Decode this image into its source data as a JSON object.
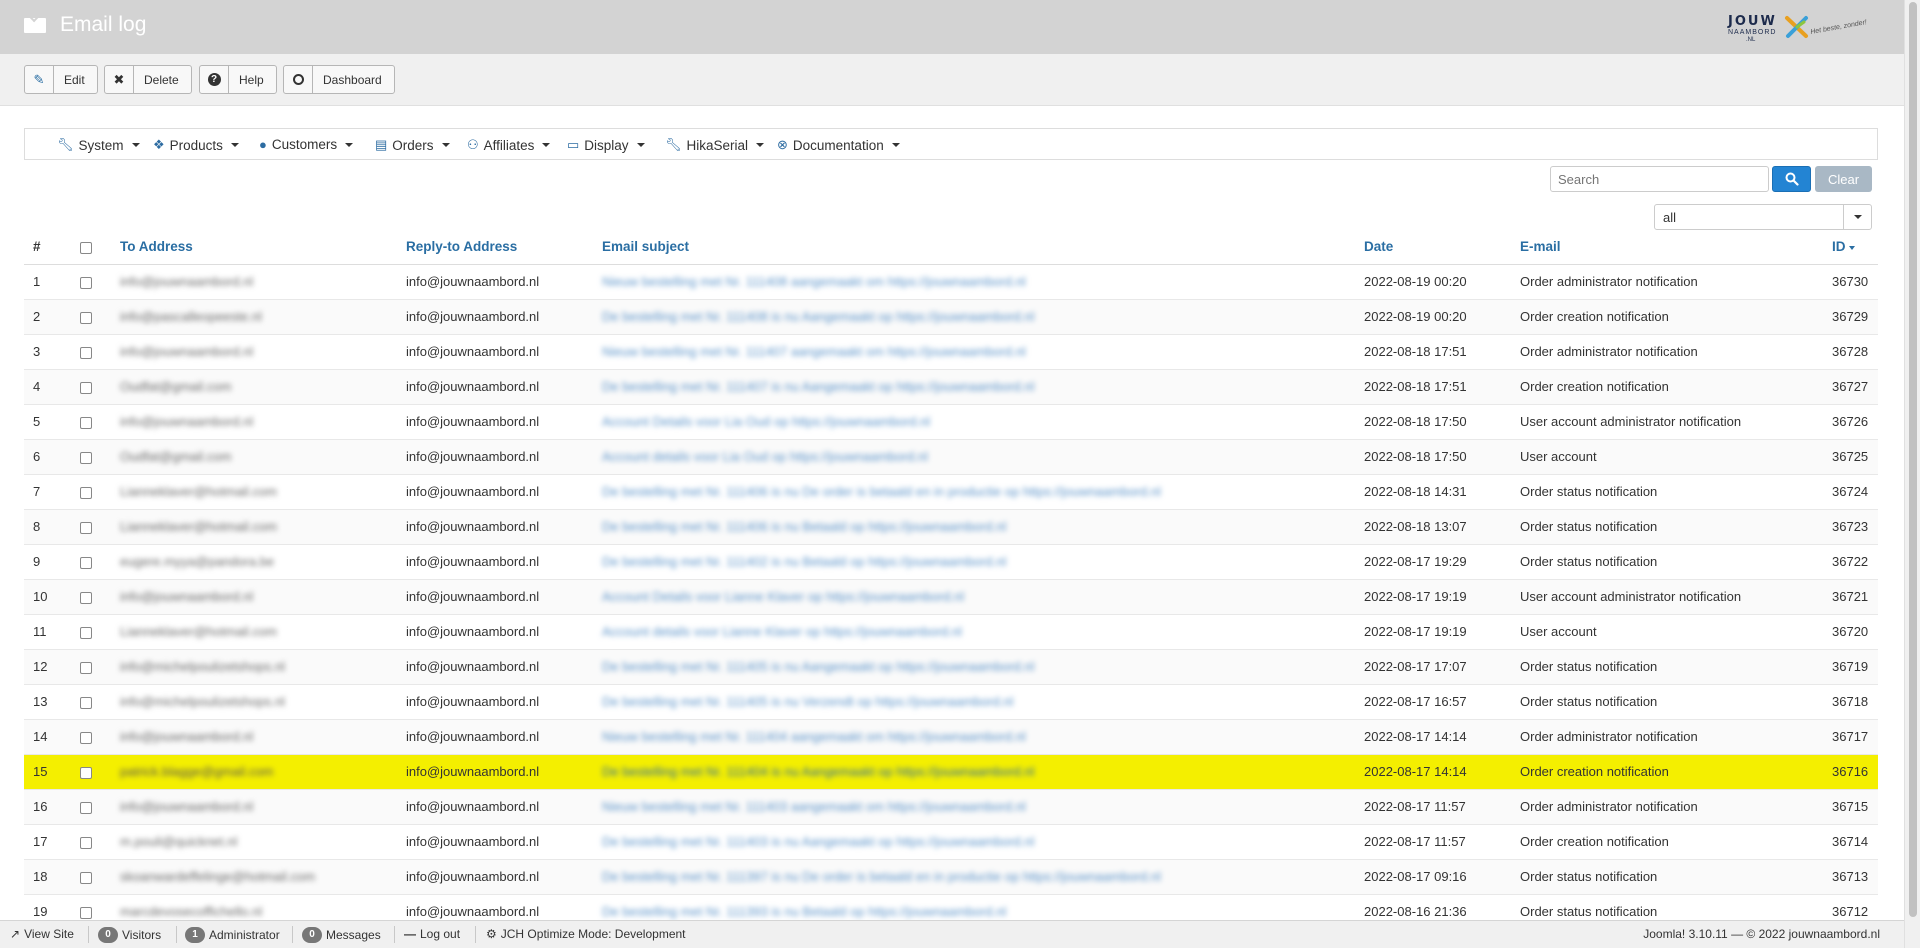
{
  "header": {
    "title": "Email log",
    "icon": "envelope-icon",
    "logo": {
      "line1": "JOUW",
      "line2": "NAAMBORD",
      "line3": ".NL",
      "tagline": "Het beste, zonder!"
    }
  },
  "toolbar": [
    {
      "label": "Edit",
      "icon": "edit-icon",
      "glyph": "✎"
    },
    {
      "label": "Delete",
      "icon": "close-icon",
      "glyph": "✖"
    },
    {
      "label": "Help",
      "icon": "help-icon",
      "glyph": "?"
    },
    {
      "label": "Dashboard",
      "icon": "dashboard-icon",
      "glyph": "◴"
    }
  ],
  "menu": [
    {
      "label": "System",
      "icon": "wrench-icon",
      "glyph": "🔧"
    },
    {
      "label": "Products",
      "icon": "cubes-icon",
      "glyph": "❖"
    },
    {
      "label": "Customers",
      "icon": "user-icon",
      "glyph": "👤"
    },
    {
      "label": "Orders",
      "icon": "credit-card-icon",
      "glyph": "▭"
    },
    {
      "label": "Affiliates",
      "icon": "users-icon",
      "glyph": "⚇"
    },
    {
      "label": "Display",
      "icon": "monitor-icon",
      "glyph": "▭"
    },
    {
      "label": "HikaSerial",
      "icon": "wrench-icon",
      "glyph": "🔧"
    },
    {
      "label": "Documentation",
      "icon": "lifebuoy-icon",
      "glyph": "⊗"
    }
  ],
  "search": {
    "placeholder": "Search",
    "clear_label": "Clear"
  },
  "filter": {
    "selected": "all"
  },
  "table": {
    "headers": {
      "num": "#",
      "to": "To Address",
      "reply": "Reply-to Address",
      "subject": "Email subject",
      "date": "Date",
      "email": "E-mail",
      "id": "ID"
    },
    "rows": [
      {
        "num": "1",
        "to": "info@jouwnaambord.nl",
        "reply": "info@jouwnaambord.nl",
        "subject": "Nieuw bestelling met Nr. 111408 aangemaakt om https://jouwnaambord.nl",
        "date": "2022-08-19 00:20",
        "type": "Order administrator notification",
        "id": "36730"
      },
      {
        "num": "2",
        "to": "info@pascalleopeeste.nl",
        "reply": "info@jouwnaambord.nl",
        "subject": "De bestelling met Nr. 111408 is nu Aangemaakt op https://jouwnaambord.nl",
        "date": "2022-08-19 00:20",
        "type": "Order creation notification",
        "id": "36729"
      },
      {
        "num": "3",
        "to": "info@jouwnaambord.nl",
        "reply": "info@jouwnaambord.nl",
        "subject": "Nieuw bestelling met Nr. 111407 aangemaakt om https://jouwnaambord.nl",
        "date": "2022-08-18 17:51",
        "type": "Order administrator notification",
        "id": "36728"
      },
      {
        "num": "4",
        "to": "Oudfat@gmail.com",
        "reply": "info@jouwnaambord.nl",
        "subject": "De bestelling met Nr. 111407 is nu Aangemaakt op https://jouwnaambord.nl",
        "date": "2022-08-18 17:51",
        "type": "Order creation notification",
        "id": "36727"
      },
      {
        "num": "5",
        "to": "info@jouwnaambord.nl",
        "reply": "info@jouwnaambord.nl",
        "subject": "Account Details voor Lia Oud op https://jouwnaambord.nl",
        "date": "2022-08-18 17:50",
        "type": "User account administrator notification",
        "id": "36726"
      },
      {
        "num": "6",
        "to": "Oudfat@gmail.com",
        "reply": "info@jouwnaambord.nl",
        "subject": "Account details voor Lia Oud op https://jouwnaambord.nl",
        "date": "2022-08-18 17:50",
        "type": "User account",
        "id": "36725"
      },
      {
        "num": "7",
        "to": "Lianneklaver@hotmail.com",
        "reply": "info@jouwnaambord.nl",
        "subject": "De bestelling met Nr. 111406 is nu De order is betaald en in productie op https://jouwnaambord.nl",
        "date": "2022-08-18 14:31",
        "type": "Order status notification",
        "id": "36724"
      },
      {
        "num": "8",
        "to": "Lianneklaver@hotmail.com",
        "reply": "info@jouwnaambord.nl",
        "subject": "De bestelling met Nr. 111406 is nu Betaald op https://jouwnaambord.nl",
        "date": "2022-08-18 13:07",
        "type": "Order status notification",
        "id": "36723"
      },
      {
        "num": "9",
        "to": "eugere.myya@pandora.be",
        "reply": "info@jouwnaambord.nl",
        "subject": "De bestelling met Nr. 111402 is nu Betaald op https://jouwnaambord.nl",
        "date": "2022-08-17 19:29",
        "type": "Order status notification",
        "id": "36722"
      },
      {
        "num": "10",
        "to": "info@jouwnaambord.nl",
        "reply": "info@jouwnaambord.nl",
        "subject": "Account Details voor Lianne Klaver op https://jouwnaambord.nl",
        "date": "2022-08-17 19:19",
        "type": "User account administrator notification",
        "id": "36721"
      },
      {
        "num": "11",
        "to": "Lianneklaver@hotmail.com",
        "reply": "info@jouwnaambord.nl",
        "subject": "Account details voor Lianne Klaver op https://jouwnaambord.nl",
        "date": "2022-08-17 19:19",
        "type": "User account",
        "id": "36720"
      },
      {
        "num": "12",
        "to": "info@michelpoulizetshops.nl",
        "reply": "info@jouwnaambord.nl",
        "subject": "De bestelling met Nr. 111405 is nu Aangemaakt op https://jouwnaambord.nl",
        "date": "2022-08-17 17:07",
        "type": "Order status notification",
        "id": "36719"
      },
      {
        "num": "13",
        "to": "info@michelpoulizetshops.nl",
        "reply": "info@jouwnaambord.nl",
        "subject": "De bestelling met Nr. 111405 is nu Verzendt op https://jouwnaambord.nl",
        "date": "2022-08-17 16:57",
        "type": "Order status notification",
        "id": "36718"
      },
      {
        "num": "14",
        "to": "info@jouwnaambord.nl",
        "reply": "info@jouwnaambord.nl",
        "subject": "Nieuw bestelling met Nr. 111404 aangemaakt om https://jouwnaambord.nl",
        "date": "2022-08-17 14:14",
        "type": "Order administrator notification",
        "id": "36717"
      },
      {
        "num": "15",
        "to": "patrick.blagge@gmail.com",
        "reply": "info@jouwnaambord.nl",
        "subject": "De bestelling met Nr. 111404 is nu Aangemaakt op https://jouwnaambord.nl",
        "date": "2022-08-17 14:14",
        "type": "Order creation notification",
        "id": "36716",
        "highlight": true
      },
      {
        "num": "16",
        "to": "info@jouwnaambord.nl",
        "reply": "info@jouwnaambord.nl",
        "subject": "Nieuw bestelling met Nr. 111403 aangemaakt om https://jouwnaambord.nl",
        "date": "2022-08-17 11:57",
        "type": "Order administrator notification",
        "id": "36715"
      },
      {
        "num": "17",
        "to": "m.pouli@quicknet.nl",
        "reply": "info@jouwnaambord.nl",
        "subject": "De bestelling met Nr. 111403 is nu Aangemaakt op https://jouwnaambord.nl",
        "date": "2022-08-17 11:57",
        "type": "Order creation notification",
        "id": "36714"
      },
      {
        "num": "18",
        "to": "skoanwardeffelinge@hotmail.com",
        "reply": "info@jouwnaambord.nl",
        "subject": "De bestelling met Nr. 111397 is nu De order is betaald en in productie op https://jouwnaambord.nl",
        "date": "2022-08-17 09:16",
        "type": "Order status notification",
        "id": "36713"
      },
      {
        "num": "19",
        "to": "marcdevosecoffichello.nl",
        "reply": "info@jouwnaambord.nl",
        "subject": "De bestelling met Nr. 111393 is nu Betaald op https://jouwnaambord.nl",
        "date": "2022-08-16 21:36",
        "type": "Order status notification",
        "id": "36712"
      }
    ]
  },
  "statusbar": {
    "view_site": "View Site",
    "visitors_count": "0",
    "visitors": "Visitors",
    "admin_count": "1",
    "admin": "Administrator",
    "messages_count": "0",
    "messages": "Messages",
    "logout": "Log out",
    "jch": "JCH Optimize Mode: Development",
    "right": "Joomla! 3.10.11 — © 2022 jouwnaambord.nl"
  },
  "colors": {
    "primary": "#2384d3",
    "highlight": "#f4ef00",
    "header_bg": "#d3d3d3",
    "link": "#2a6ea3"
  }
}
